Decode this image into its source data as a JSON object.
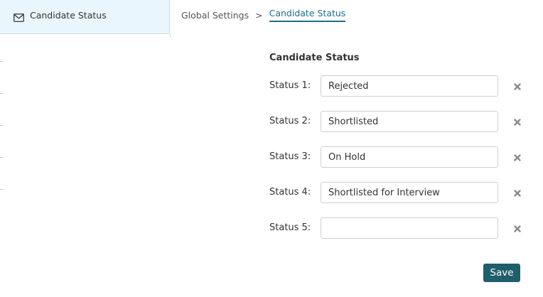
{
  "sidebar": {
    "active_item": {
      "label": "Candidate Status",
      "icon": "envelope-icon"
    }
  },
  "breadcrumb": {
    "items": [
      "Global Settings",
      "Candidate Status"
    ],
    "separator": ">"
  },
  "form": {
    "title": "Candidate Status",
    "statuses": [
      {
        "label": "Status 1:",
        "value": "Rejected",
        "placeholder": ""
      },
      {
        "label": "Status 2:",
        "value": "Shortlisted",
        "placeholder": ""
      },
      {
        "label": "Status 3:",
        "value": "On Hold",
        "placeholder": ""
      },
      {
        "label": "Status 4:",
        "value": "Shortlisted for Interview",
        "placeholder": ""
      },
      {
        "label": "Status 5:",
        "value": "",
        "placeholder": ""
      }
    ],
    "remove_icon": "close-icon",
    "save_label": "Save"
  },
  "colors": {
    "accent": "#1f6d8a",
    "save_button": "#1e5f6b",
    "sidebar_active_bg": "#eaf6fd"
  }
}
